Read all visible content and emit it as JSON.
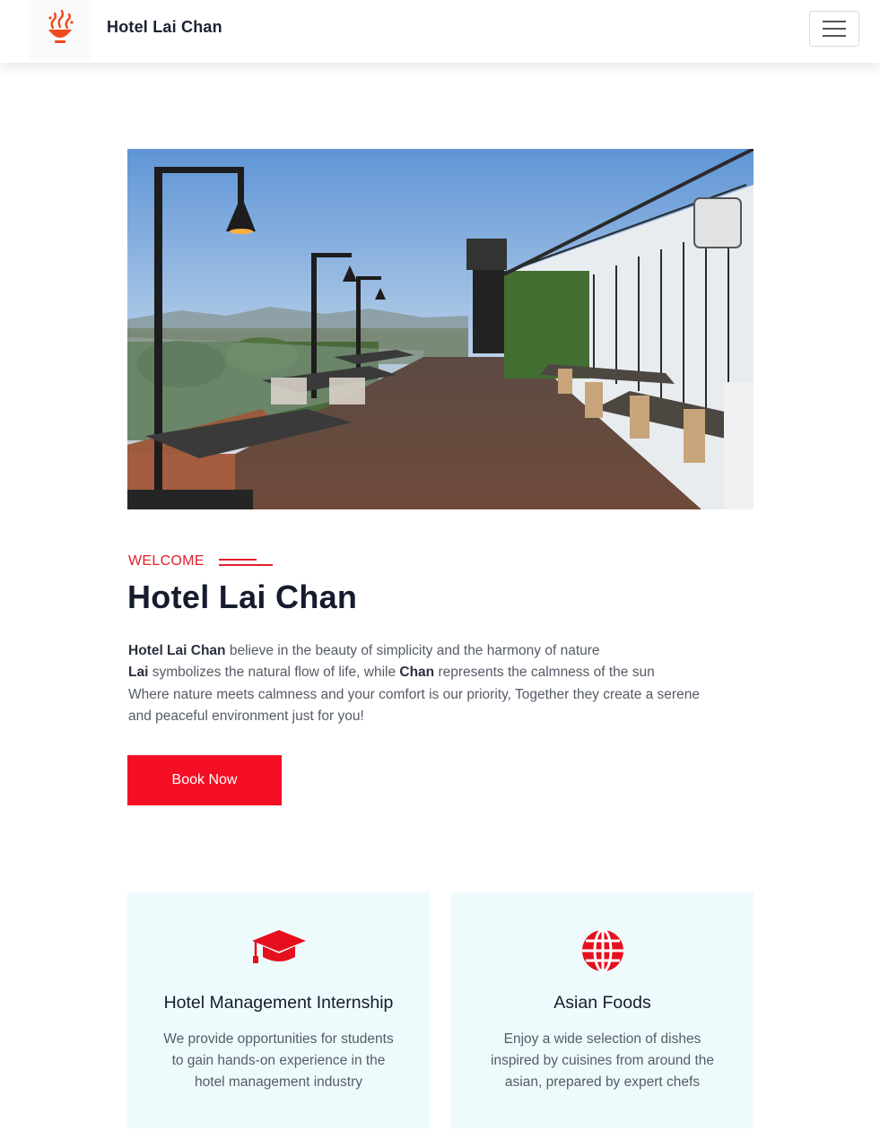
{
  "navbar": {
    "brand": "Hotel Lai Chan",
    "logo_icon": "steaming-bowl-icon",
    "menu_icon": "hamburger-menu-icon"
  },
  "hero": {
    "image": "rooftop-restaurant-terrace-photo"
  },
  "about": {
    "eyebrow": "WELCOME",
    "title": "Hotel Lai Chan",
    "lines": [
      {
        "strong": "Hotel Lai Chan",
        "rest": " believe in the beauty of simplicity and the harmony of nature"
      },
      {
        "strong": "Lai",
        "mid": " symbolizes the natural flow of life, while ",
        "strong2": "Chan",
        "rest": " represents the calmness of the sun"
      },
      {
        "text": "Where nature meets calmness and your comfort is our priority, Together they create a serene"
      },
      {
        "text": "and peaceful environment just for you!"
      }
    ],
    "button_label": "Book Now"
  },
  "features": [
    {
      "icon": "graduation-cap-icon",
      "title": "Hotel Management Internship",
      "text_lines": [
        "We provide opportunities for students",
        "to gain hands-on experience in the",
        "hotel management industry"
      ]
    },
    {
      "icon": "globe-icon",
      "title": "Asian Foods",
      "text_lines": [
        "Enjoy a wide selection of dishes",
        "inspired by cuisines from around the",
        "asian, prepared by expert chefs"
      ]
    }
  ],
  "colors": {
    "accent": "#f50f24",
    "heading": "#151c2e",
    "card_bg": "#eefbfc"
  }
}
